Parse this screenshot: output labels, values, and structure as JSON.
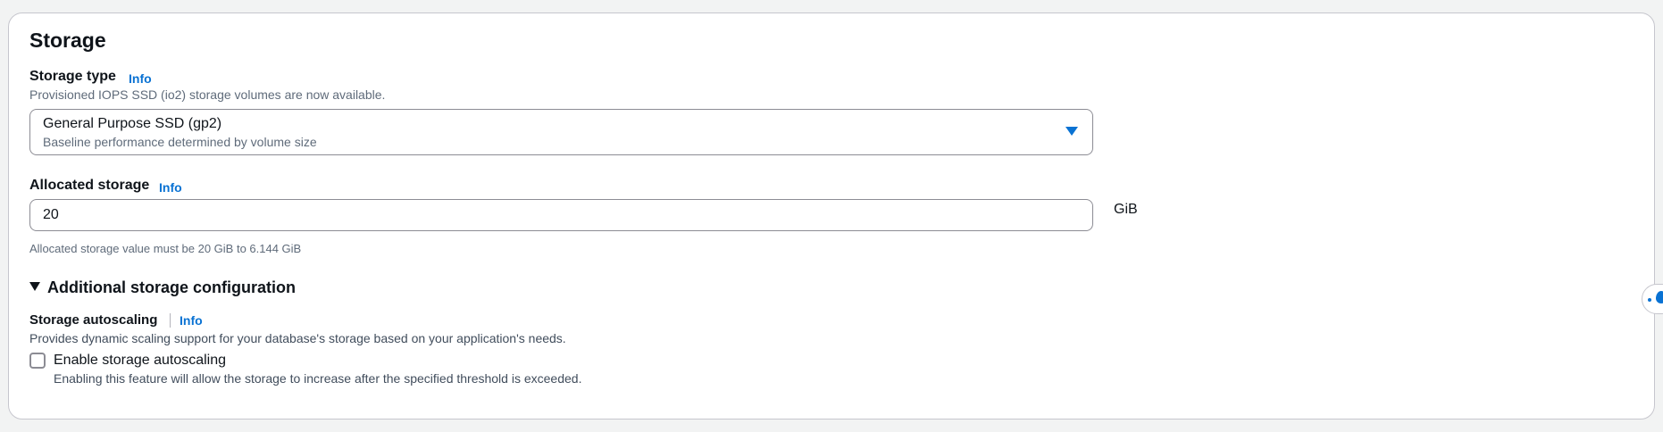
{
  "section": {
    "title": "Storage"
  },
  "storage_type": {
    "label": "Storage type",
    "info": "Info",
    "description": "Provisioned IOPS SSD (io2) storage volumes are now available.",
    "selected_value": "General Purpose SSD (gp2)",
    "selected_description": "Baseline performance determined by volume size"
  },
  "allocated_storage": {
    "label": "Allocated storage",
    "info": "Info",
    "value": "20",
    "unit": "GiB",
    "constraint": "Allocated storage value must be 20 GiB to 6.144 GiB"
  },
  "additional_config": {
    "label": "Additional storage configuration",
    "expanded": true
  },
  "autoscaling": {
    "label": "Storage autoscaling",
    "info": "Info",
    "description": "Provides dynamic scaling support for your database's storage based on your application's needs.",
    "checkbox_label": "Enable storage autoscaling",
    "checkbox_description": "Enabling this feature will allow the storage to increase after the specified threshold is exceeded.",
    "checked": false
  },
  "colors": {
    "accent": "#0972d3",
    "text": "#0f141a",
    "secondary_text": "#5f6b7a",
    "border": "#8c8c94"
  },
  "icons": {
    "dropdown": "caret-down-icon",
    "expander": "triangle-down-icon",
    "side_widget": "water-drop-icon"
  }
}
